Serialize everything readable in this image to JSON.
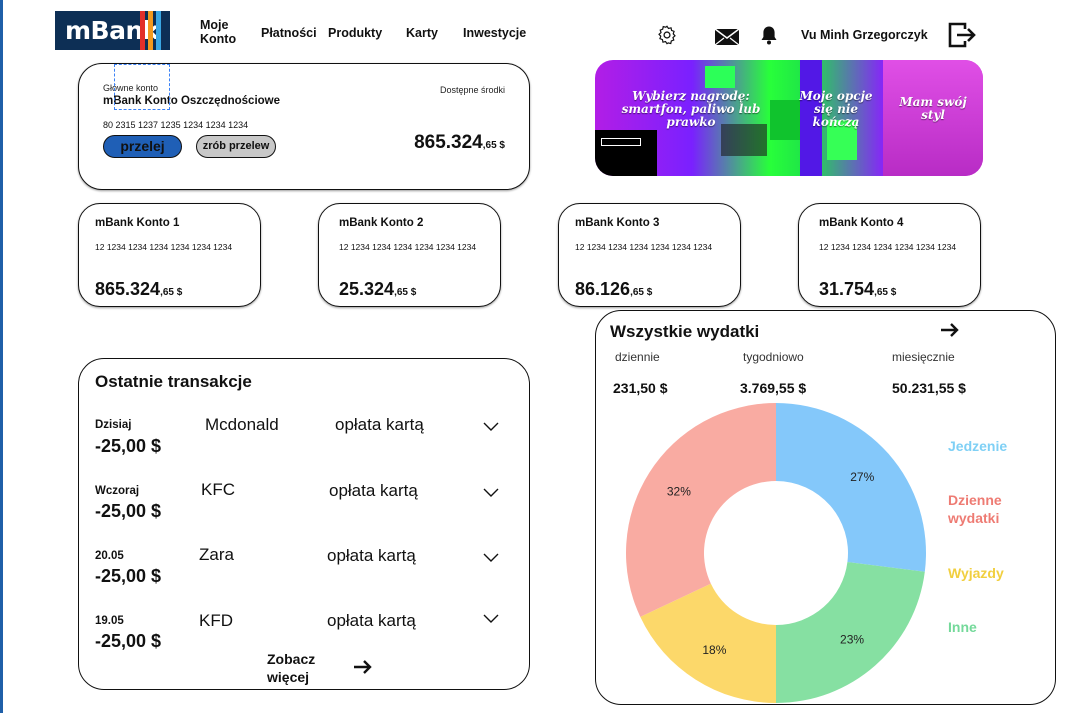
{
  "header": {
    "logo_text": "mBank",
    "nav": [
      {
        "label": "Moje\nKonto"
      },
      {
        "label": "Płatności"
      },
      {
        "label": "Produkty"
      },
      {
        "label": "Karty"
      },
      {
        "label": "Inwestycje"
      }
    ],
    "user_name": "Vu Minh Grzegorczyk",
    "icons": [
      "settings-icon",
      "mail-icon",
      "bell-icon",
      "logout-icon"
    ]
  },
  "main_account": {
    "label": "Główne konto",
    "name": "mBank Konto Oszczędnościowe",
    "number": "80 2315 1237 1235 1234 1234 1234",
    "available_label": "Dostępne środki",
    "balance_main": "865.324",
    "balance_cents": ",65 $",
    "transfer_button": "przelej",
    "make_transfer_button": "zrób przelew"
  },
  "banner": {
    "panel1": "Wybierz nagrodę:\nsmartfon, paliwo lub\nprawko",
    "panel2": "Moje opcje\nsię nie\nkończą",
    "panel3": "Mam swój\nstyl"
  },
  "accounts": [
    {
      "title": "mBank Konto 1",
      "number": "12 1234 1234 1234 1234 1234 1234",
      "balance_main": "865.324",
      "balance_cents": ",65 $"
    },
    {
      "title": "mBank Konto 2",
      "number": "12 1234 1234 1234 1234 1234 1234",
      "balance_main": "25.324",
      "balance_cents": ",65 $"
    },
    {
      "title": "mBank Konto 3",
      "number": "12 1234 1234 1234 1234 1234 1234",
      "balance_main": "86.126",
      "balance_cents": ",65 $"
    },
    {
      "title": "mBank Konto 4",
      "number": "12 1234 1234 1234 1234 1234 1234",
      "balance_main": "31.754",
      "balance_cents": ",65 $"
    }
  ],
  "transactions": {
    "title": "Ostatnie transakcje",
    "items": [
      {
        "date": "Dzisiaj",
        "amount": "-25,00 $",
        "merchant": "Mcdonald",
        "type": "opłata kartą"
      },
      {
        "date": "Wczoraj",
        "amount": "-25,00 $",
        "merchant": "KFC",
        "type": "opłata kartą"
      },
      {
        "date": "20.05",
        "amount": "-25,00 $",
        "merchant": "Zara",
        "type": "opłata kartą"
      },
      {
        "date": "19.05",
        "amount": "-25,00 $",
        "merchant": "KFD",
        "type": "opłata kartą"
      }
    ],
    "see_more": "Zobacz\nwięcej"
  },
  "spending": {
    "title": "Wszystkie wydatki",
    "periods": [
      {
        "label": "dziennie",
        "value": "231,50 $"
      },
      {
        "label": "tygodniowo",
        "value": "3.769,55 $"
      },
      {
        "label": "miesięcznie",
        "value": "50.231,55 $"
      }
    ]
  },
  "chart_data": {
    "type": "pie",
    "categories": [
      "Jedzenie",
      "Inne",
      "Wyjazdy",
      "Dzienne\nwydatki"
    ],
    "values": [
      27,
      23,
      18,
      32
    ],
    "value_labels": [
      "27%",
      "23%",
      "18%",
      "32%"
    ],
    "colors": [
      "#84c8fa",
      "#86e0a2",
      "#fcd86a",
      "#f9aba2"
    ],
    "legend": [
      {
        "label": "Jedzenie",
        "color": "#7fd0f5"
      },
      {
        "label": "Dzienne\nwydatki",
        "color": "#ee7b73"
      },
      {
        "label": "Wyjazdy",
        "color": "#f1cf3f"
      },
      {
        "label": "Inne",
        "color": "#74d99a"
      }
    ],
    "legend_position": "right",
    "donut": true
  }
}
